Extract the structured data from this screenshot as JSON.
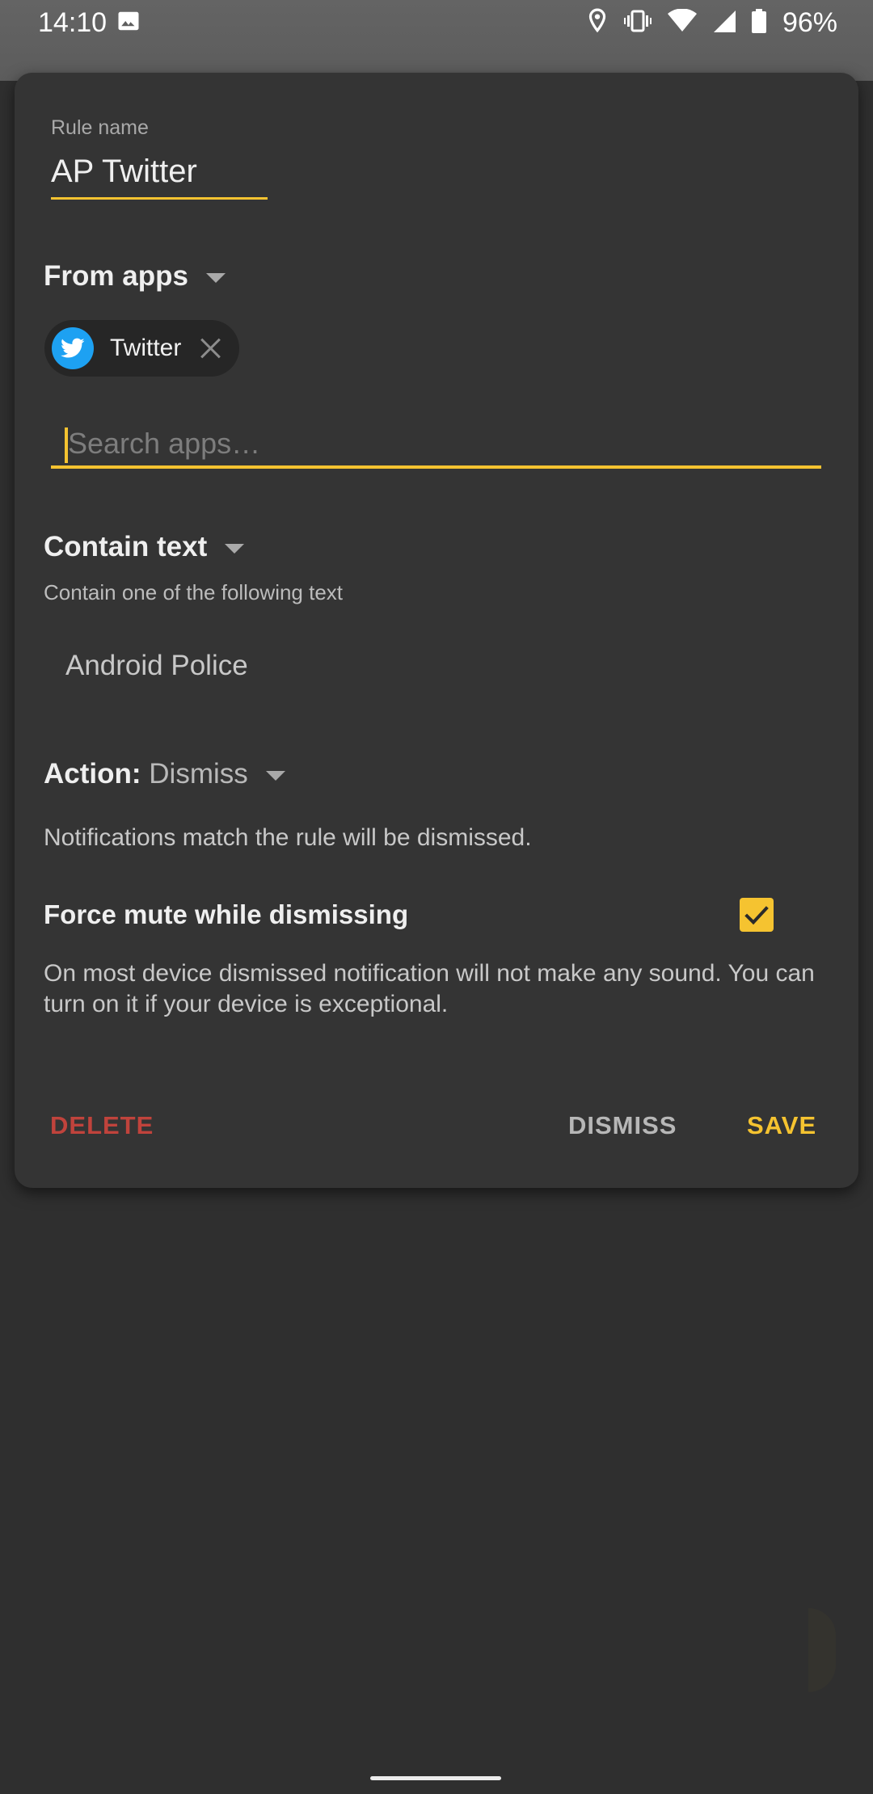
{
  "status_bar": {
    "time": "14:10",
    "battery": "96%",
    "icons": [
      "image-icon",
      "location-icon",
      "vibrate-icon",
      "wifi-icon",
      "signal-icon",
      "battery-icon"
    ]
  },
  "dialog": {
    "rule_name_label": "Rule name",
    "rule_name_value": "AP Twitter",
    "from_apps_title": "From apps",
    "selected_app": {
      "name": "Twitter",
      "icon": "twitter-icon"
    },
    "search_placeholder": "Search apps…",
    "contain_text_title": "Contain text",
    "contain_text_caption": "Contain one of the following text",
    "contain_text_value": "Android Police",
    "action_label": "Action:",
    "action_value": "Dismiss",
    "action_description": "Notifications match the rule will be dismissed.",
    "force_mute_title": "Force mute while dismissing",
    "force_mute_checked": true,
    "force_mute_description": "On most device dismissed notification will not make any sound. You can turn on it if your device is exceptional.",
    "buttons": {
      "delete": "DELETE",
      "dismiss": "DISMISS",
      "save": "SAVE"
    }
  },
  "colors": {
    "accent": "#f5c330",
    "delete": "#c0433c",
    "dialog_bg": "#343434",
    "twitter": "#1da1f2"
  }
}
